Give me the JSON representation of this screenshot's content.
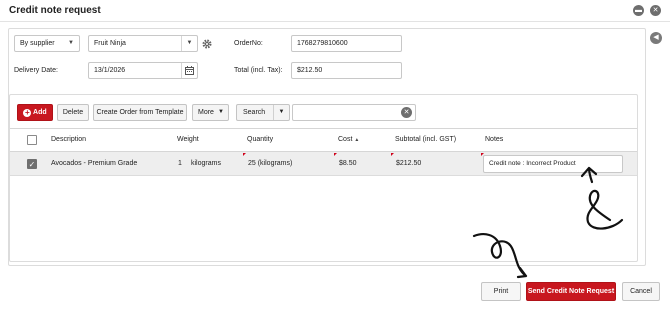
{
  "window": {
    "title": "Credit note request"
  },
  "icons": {
    "minimize": "minimize-icon",
    "close": "close-icon",
    "collapse": "chevron-left-icon",
    "settings": "gear-icon",
    "calendar": "calendar-icon",
    "clear": "clear-icon",
    "add": "plus-icon"
  },
  "form": {
    "supplier_mode": "By supplier",
    "supplier": "Fruit Ninja",
    "order_no_label": "OrderNo:",
    "order_no": "1768279810600",
    "delivery_date_label": "Delivery Date:",
    "delivery_date": "13/1/2026",
    "total_label": "Total (incl. Tax):",
    "total": "$212.50"
  },
  "toolbar": {
    "add_label": "Add",
    "delete_label": "Delete",
    "create_from_template_label": "Create Order from Template",
    "more_label": "More",
    "search_label": "Search",
    "search_value": ""
  },
  "table": {
    "headers": {
      "description": "Description",
      "weight": "Weight",
      "quantity": "Quantity",
      "cost": "Cost",
      "cost_sort": "▲",
      "subtotal": "Subtotal (incl. GST)",
      "notes": "Notes"
    },
    "rows": [
      {
        "checked": true,
        "description": "Avocados - Premium Grade",
        "weight_value": "1",
        "weight_unit": "kilograms",
        "quantity": "25 (kilograms)",
        "cost": "$8.50",
        "subtotal": "$212.50",
        "notes": "Credit note : Incorrect Product"
      }
    ]
  },
  "footer": {
    "print_label": "Print",
    "send_label": "Send Credit Note Request",
    "cancel_label": "Cancel"
  },
  "colors": {
    "brand_red": "#c8171f",
    "row_bg": "#eeeeee",
    "border": "#dcdcdc"
  }
}
